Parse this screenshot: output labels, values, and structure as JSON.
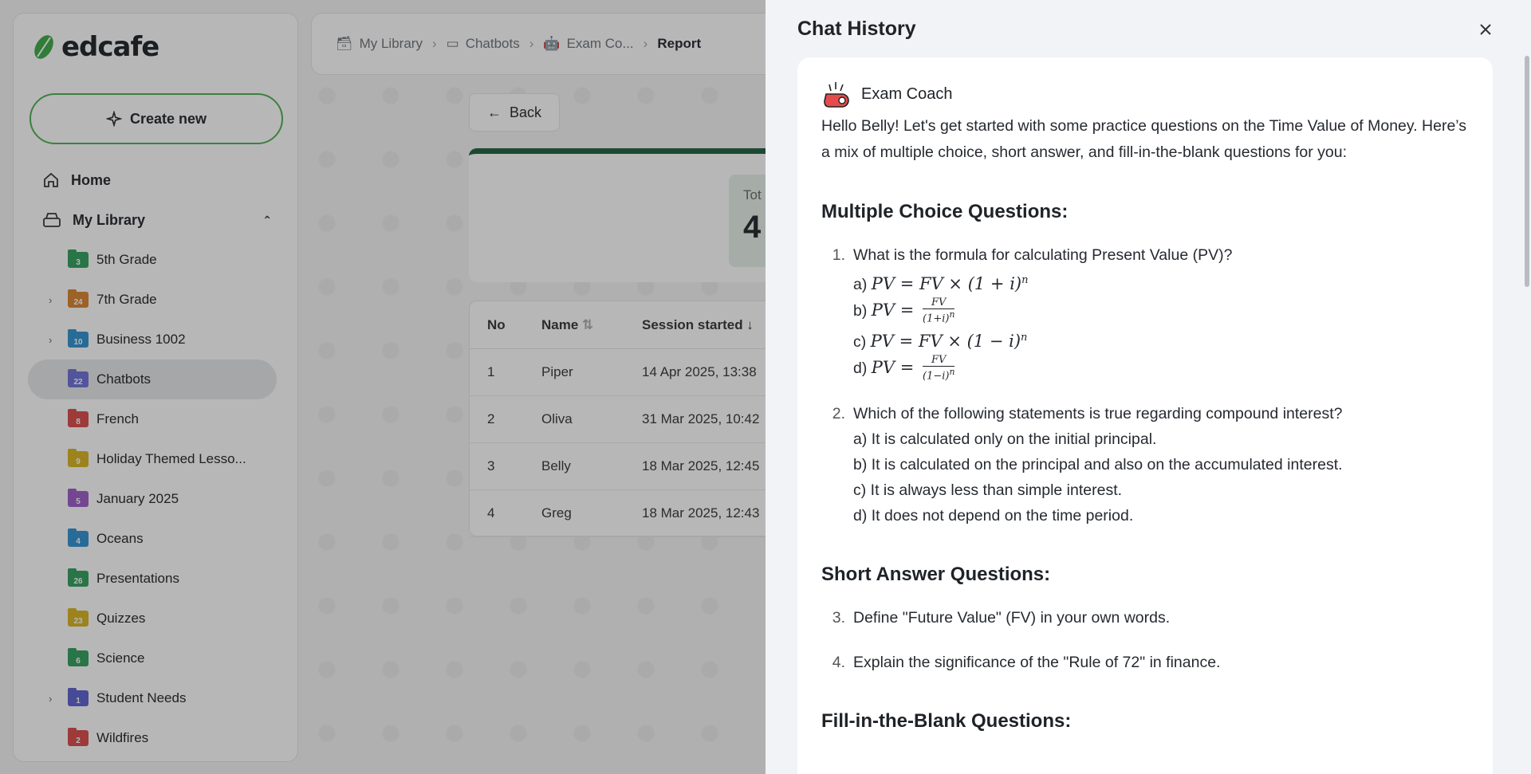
{
  "app": {
    "brand": "edcafe",
    "create_label": "Create new",
    "nav": {
      "home": "Home",
      "library": "My Library"
    },
    "folders": [
      {
        "name": "5th Grade",
        "count": "3",
        "color": "#2e9e5b",
        "expandable": false,
        "active": false
      },
      {
        "name": "7th Grade",
        "count": "24",
        "color": "#d9822b",
        "expandable": true,
        "active": false
      },
      {
        "name": "Business 1002",
        "count": "10",
        "color": "#2f8fd0",
        "expandable": true,
        "active": false
      },
      {
        "name": "Chatbots",
        "count": "22",
        "color": "#6a6fd6",
        "expandable": false,
        "active": true
      },
      {
        "name": "French",
        "count": "8",
        "color": "#d94848",
        "expandable": false,
        "active": false
      },
      {
        "name": "Holiday Themed Lesso...",
        "count": "9",
        "color": "#d8b31c",
        "expandable": false,
        "active": false
      },
      {
        "name": "January 2025",
        "count": "5",
        "color": "#9b59c9",
        "expandable": false,
        "active": false
      },
      {
        "name": "Oceans",
        "count": "4",
        "color": "#2f8fd0",
        "expandable": false,
        "active": false
      },
      {
        "name": "Presentations",
        "count": "26",
        "color": "#2e9e5b",
        "expandable": false,
        "active": false
      },
      {
        "name": "Quizzes",
        "count": "23",
        "color": "#d8b31c",
        "expandable": false,
        "active": false
      },
      {
        "name": "Science",
        "count": "6",
        "color": "#2e9e5b",
        "expandable": false,
        "active": false
      },
      {
        "name": "Student Needs",
        "count": "1",
        "color": "#5a5fd0",
        "expandable": true,
        "active": false
      },
      {
        "name": "Wildfires",
        "count": "2",
        "color": "#d94848",
        "expandable": false,
        "active": false
      }
    ],
    "breadcrumb": [
      "My Library",
      "Chatbots",
      "Exam Co...",
      "Report"
    ],
    "back_label": "Back",
    "stat": {
      "label": "Tot",
      "value": "4"
    },
    "table": {
      "headers": [
        "No",
        "Name",
        "Session started"
      ],
      "rows": [
        [
          "1",
          "Piper",
          "14 Apr 2025, 13:38"
        ],
        [
          "2",
          "Oliva",
          "31 Mar 2025, 10:42"
        ],
        [
          "3",
          "Belly",
          "18 Mar 2025, 12:45"
        ],
        [
          "4",
          "Greg",
          "18 Mar 2025, 12:43"
        ]
      ]
    }
  },
  "drawer": {
    "title": "Chat History",
    "bot_name": "Exam Coach",
    "intro": "Hello Belly! Let's get started with some practice questions on the Time Value of Money. Here’s a mix of multiple choice, short answer, and fill-in-the-blank questions for you:",
    "sections": {
      "mcq": "Multiple Choice Questions:",
      "short": "Short Answer Questions:",
      "blank": "Fill-in-the-Blank Questions:"
    },
    "q1": {
      "num": "1.",
      "text": "What is the formula for calculating Present Value (PV)?",
      "a": "a)",
      "b": "b)",
      "c": "c)",
      "d": "d)"
    },
    "q2": {
      "num": "2.",
      "text": "Which of the following statements is true regarding compound interest?",
      "options": [
        "a) It is calculated only on the initial principal.",
        "b) It is calculated on the principal and also on the accumulated interest.",
        "c) It is always less than simple interest.",
        "d) It does not depend on the time period."
      ]
    },
    "q3": {
      "num": "3.",
      "text": "Define \"Future Value\" (FV) in your own words."
    },
    "q4": {
      "num": "4.",
      "text": "Explain the significance of the \"Rule of 72\" in finance."
    }
  }
}
